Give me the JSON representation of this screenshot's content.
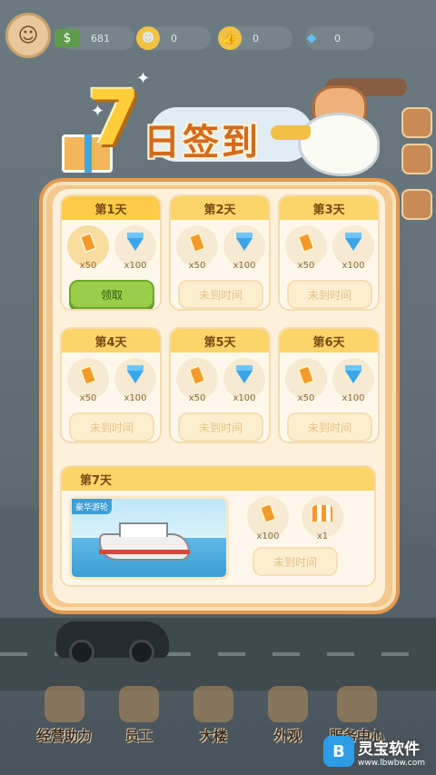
{
  "topbar": {
    "resources": [
      {
        "icon": "cash-icon",
        "value": "681"
      },
      {
        "icon": "smiley-icon",
        "value": "0"
      },
      {
        "icon": "thumb-up-icon",
        "value": "0"
      },
      {
        "icon": "diamond-icon",
        "value": "0"
      }
    ]
  },
  "title": {
    "seven": "7",
    "text": "日签到"
  },
  "days": [
    {
      "label": "第1天",
      "rewards": [
        {
          "icon": "ticket-icon",
          "count": "x50"
        },
        {
          "icon": "diamond-icon",
          "count": "x100"
        }
      ],
      "button": "领取",
      "state": "claim"
    },
    {
      "label": "第2天",
      "rewards": [
        {
          "icon": "ticket-icon",
          "count": "x50"
        },
        {
          "icon": "diamond-icon",
          "count": "x100"
        }
      ],
      "button": "未到时间",
      "state": "wait"
    },
    {
      "label": "第3天",
      "rewards": [
        {
          "icon": "ticket-icon",
          "count": "x50"
        },
        {
          "icon": "diamond-icon",
          "count": "x100"
        }
      ],
      "button": "未到时间",
      "state": "wait"
    },
    {
      "label": "第4天",
      "rewards": [
        {
          "icon": "ticket-icon",
          "count": "x50"
        },
        {
          "icon": "diamond-icon",
          "count": "x100"
        }
      ],
      "button": "未到时间",
      "state": "wait"
    },
    {
      "label": "第5天",
      "rewards": [
        {
          "icon": "ticket-icon",
          "count": "x50"
        },
        {
          "icon": "diamond-icon",
          "count": "x100"
        }
      ],
      "button": "未到时间",
      "state": "wait"
    },
    {
      "label": "第6天",
      "rewards": [
        {
          "icon": "ticket-icon",
          "count": "x50"
        },
        {
          "icon": "diamond-icon",
          "count": "x100"
        }
      ],
      "button": "未到时间",
      "state": "wait"
    }
  ],
  "day7": {
    "label": "第7天",
    "ship_tag": "豪华游轮",
    "rewards": [
      {
        "icon": "ticket-icon",
        "count": "x100"
      },
      {
        "icon": "shop-awning-icon",
        "count": "x1"
      }
    ],
    "button": "未到时间"
  },
  "bottom_nav": [
    {
      "label": "经营助力",
      "icon": "helper-icon"
    },
    {
      "label": "员工",
      "icon": "staff-icon"
    },
    {
      "label": "大楼",
      "icon": "building-icon"
    },
    {
      "label": "外观",
      "icon": "palette-icon"
    },
    {
      "label": "服务中心",
      "icon": "service-star-icon"
    }
  ],
  "watermark": {
    "name": "灵宝软件",
    "url": "www.lbwbw.com"
  },
  "colors": {
    "accent": "#fccc4a",
    "claim": "#9acd4a",
    "panel": "#f4c88c"
  }
}
